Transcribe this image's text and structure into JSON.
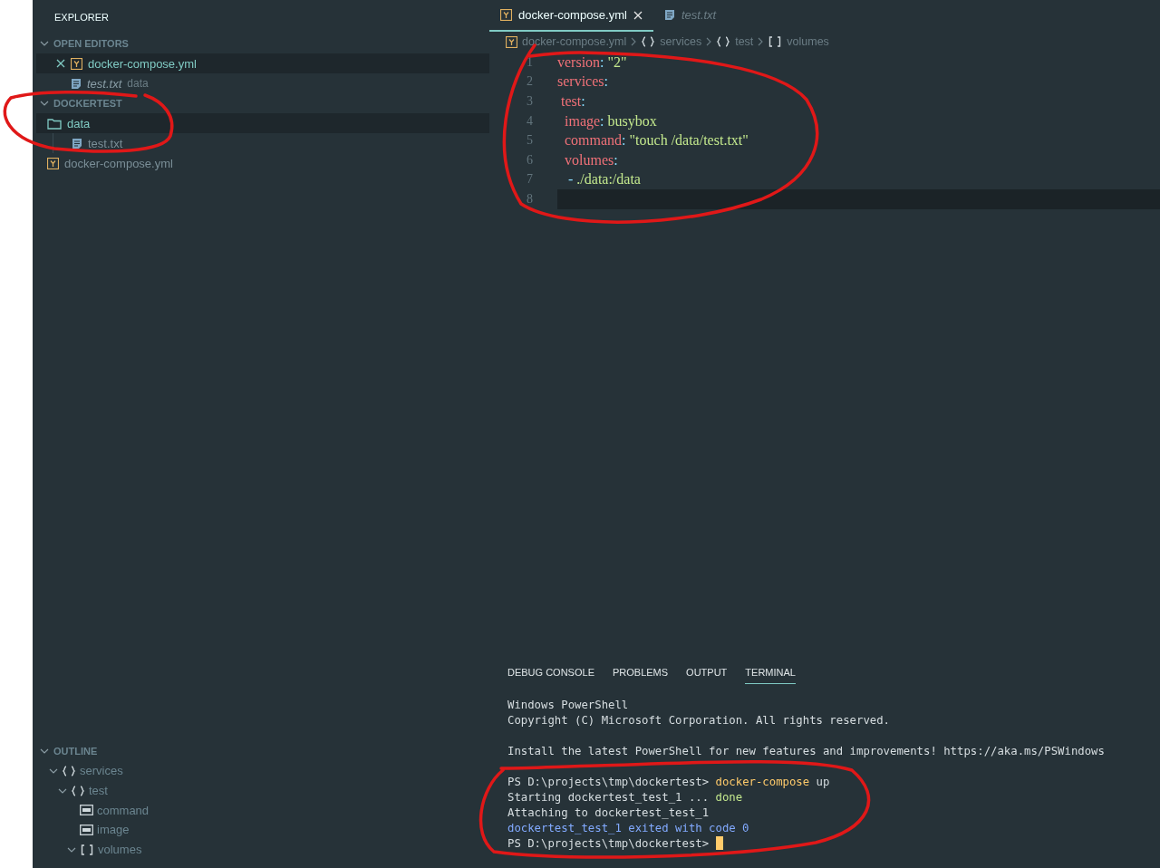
{
  "explorer": {
    "title": "EXPLORER",
    "open_editors": {
      "title": "OPEN EDITORS",
      "expanded": true,
      "items": [
        {
          "name": "docker-compose.yml",
          "kind": "yaml",
          "selected": true,
          "preview": false
        },
        {
          "name": "test.txt",
          "description": "data",
          "kind": "text",
          "selected": false,
          "preview": true
        }
      ]
    },
    "folder": {
      "title": "DOCKERTEST",
      "expanded": true,
      "items": [
        {
          "name": "data",
          "kind": "folder",
          "selected": true,
          "children": [
            {
              "name": "test.txt",
              "kind": "text",
              "selected": false
            }
          ]
        },
        {
          "name": "docker-compose.yml",
          "kind": "yaml",
          "selected": false
        }
      ]
    },
    "outline": {
      "title": "OUTLINE",
      "expanded": true,
      "items": [
        {
          "name": "services",
          "kind": "object",
          "expanded": true,
          "children": [
            {
              "name": "test",
              "kind": "object",
              "expanded": true,
              "children": [
                {
                  "name": "command",
                  "kind": "string"
                },
                {
                  "name": "image",
                  "kind": "string"
                },
                {
                  "name": "volumes",
                  "kind": "array",
                  "expanded": true
                }
              ]
            }
          ]
        }
      ]
    }
  },
  "editor": {
    "tabs": [
      {
        "label": "docker-compose.yml",
        "kind": "yaml",
        "selected": true,
        "preview": false
      },
      {
        "label": "test.txt",
        "kind": "text",
        "selected": false,
        "preview": true
      }
    ],
    "breadcrumbs": [
      {
        "label": "docker-compose.yml",
        "kind": "file"
      },
      {
        "label": "services",
        "kind": "object"
      },
      {
        "label": "test",
        "kind": "object"
      },
      {
        "label": "volumes",
        "kind": "array"
      }
    ],
    "lines": [
      {
        "number": "1",
        "current": false,
        "tokens": [
          {
            "kind": "key",
            "text": "version"
          },
          {
            "kind": "punct",
            "text": ": "
          },
          {
            "kind": "string",
            "text": "\"2\""
          }
        ]
      },
      {
        "number": "2",
        "current": false,
        "tokens": [
          {
            "kind": "key",
            "text": "services"
          },
          {
            "kind": "punct",
            "text": ":"
          }
        ]
      },
      {
        "number": "3",
        "current": false,
        "tokens": [
          {
            "kind": "key",
            "text": " test"
          },
          {
            "kind": "punct",
            "text": ":"
          }
        ]
      },
      {
        "number": "4",
        "current": false,
        "tokens": [
          {
            "kind": "key",
            "text": "  image"
          },
          {
            "kind": "punct",
            "text": ": "
          },
          {
            "kind": "string",
            "text": "busybox"
          }
        ]
      },
      {
        "number": "5",
        "current": false,
        "tokens": [
          {
            "kind": "key",
            "text": "  command"
          },
          {
            "kind": "punct",
            "text": ": "
          },
          {
            "kind": "string",
            "text": "\"touch /data/test.txt\""
          }
        ]
      },
      {
        "number": "6",
        "current": false,
        "tokens": [
          {
            "kind": "key",
            "text": "  volumes"
          },
          {
            "kind": "punct",
            "text": ":"
          }
        ]
      },
      {
        "number": "7",
        "current": false,
        "tokens": [
          {
            "kind": "punct",
            "text": "   - "
          },
          {
            "kind": "string",
            "text": "./data:/data"
          }
        ]
      },
      {
        "number": "8",
        "current": true
      }
    ]
  },
  "panel": {
    "tabs": [
      {
        "label": "DEBUG CONSOLE",
        "selected": false
      },
      {
        "label": "PROBLEMS",
        "selected": false
      },
      {
        "label": "OUTPUT",
        "selected": false
      },
      {
        "label": "TERMINAL",
        "selected": true
      }
    ],
    "terminal": [
      [
        {
          "cursor": false,
          "segments": [
            {
              "kind": "plain",
              "text": "Windows PowerShell"
            }
          ]
        },
        {
          "cursor": false,
          "segments": [
            {
              "kind": "plain",
              "text": "Copyright (C) Microsoft Corporation. All rights reserved."
            }
          ]
        }
      ],
      [
        {
          "cursor": false,
          "segments": [
            {
              "kind": "plain",
              "text": "Install the latest PowerShell for new features and improvements! https://aka.ms/PSWindows"
            }
          ]
        }
      ],
      [
        {
          "cursor": false,
          "segments": [
            {
              "kind": "plain",
              "text": "PS D:\\projects\\tmp\\dockertest> "
            },
            {
              "kind": "command",
              "text": "docker-compose"
            },
            {
              "kind": "plain",
              "text": " up"
            }
          ]
        },
        {
          "cursor": false,
          "segments": [
            {
              "kind": "plain",
              "text": "Starting dockertest_test_1 ... "
            },
            {
              "kind": "success",
              "text": "done"
            }
          ]
        },
        {
          "cursor": false,
          "segments": [
            {
              "kind": "plain",
              "text": "Attaching to dockertest_test_1"
            }
          ]
        },
        {
          "cursor": false,
          "segments": [
            {
              "kind": "info",
              "text": "dockertest_test_1 exited with code 0"
            }
          ]
        },
        {
          "cursor": true,
          "segments": [
            {
              "kind": "plain",
              "text": "PS D:\\projects\\tmp\\dockertest> "
            }
          ]
        }
      ]
    ]
  },
  "annotations": [
    {
      "kind": "circle"
    },
    {
      "kind": "circle"
    },
    {
      "kind": "circle"
    }
  ]
}
